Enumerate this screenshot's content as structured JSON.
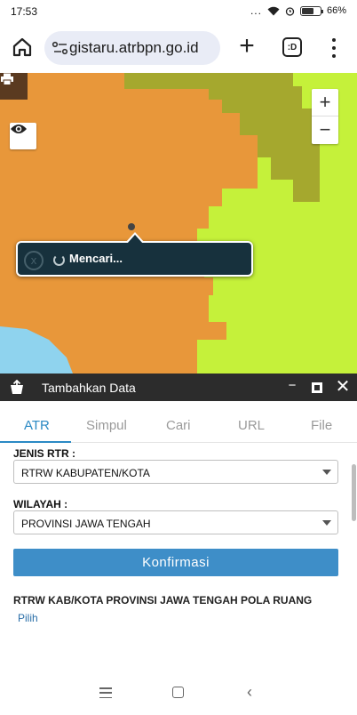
{
  "status": {
    "time": "17:53",
    "dots": "...",
    "battery_text": "66%",
    "battery_level": 0.66
  },
  "browser": {
    "url": "gistaru.atrbpn.go.id",
    "tabs_label": ":D",
    "plus_label": "+"
  },
  "map": {
    "colors": {
      "orange": "#e8973a",
      "olive": "#a5a82e",
      "lime": "#c5f13a",
      "water": "#8fd3ee"
    },
    "zoom_in": "+",
    "zoom_out": "−",
    "popup": {
      "close": "x",
      "text": "Mencari..."
    }
  },
  "panel": {
    "title": "Tambahkan Data",
    "minimize": "−",
    "close": "✕",
    "tabs": [
      {
        "label": "ATR",
        "active": true
      },
      {
        "label": "Simpul",
        "active": false
      },
      {
        "label": "Cari",
        "active": false
      },
      {
        "label": "URL",
        "active": false
      },
      {
        "label": "File",
        "active": false
      }
    ],
    "jenis_label": "JENIS RTR :",
    "jenis_value": "RTRW KABUPATEN/KOTA",
    "wilayah_label": "WILAYAH :",
    "wilayah_value": "PROVINSI JAWA TENGAH",
    "confirm": "Konfirmasi",
    "result_title": "RTRW KAB/KOTA PROVINSI JAWA TENGAH POLA RUANG",
    "result_link": "Pilih",
    "accent": "#2b8ac4"
  },
  "nav": {
    "back": "‹"
  }
}
